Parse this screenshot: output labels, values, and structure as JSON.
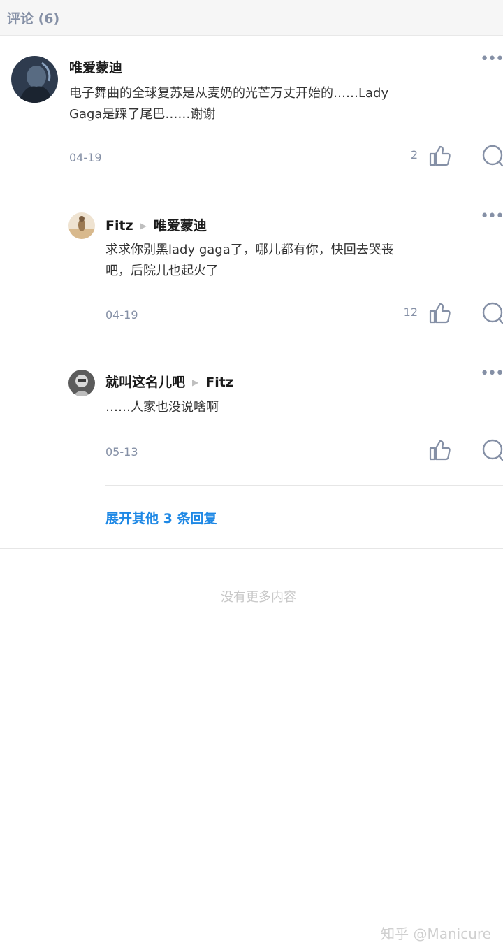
{
  "header": {
    "title": "评论 (6)"
  },
  "comments": [
    {
      "author": "唯爱蒙迪",
      "reply_to": "",
      "content_line1": "电子舞曲的全球复苏是从麦奶的光芒万丈开始的……Lady",
      "content_line2": "Gaga是踩了尾巴……谢谢",
      "date": "04-19",
      "likes": "2"
    },
    {
      "author": "Fitz",
      "reply_to": "唯爱蒙迪",
      "content_line1": "求求你别黑lady gaga了，哪儿都有你，快回去哭丧",
      "content_line2": "吧，后院儿也起火了",
      "date": "04-19",
      "likes": "12"
    },
    {
      "author": "就叫这名儿吧",
      "reply_to": "Fitz",
      "content_line1": "……人家也没说啥啊",
      "content_line2": "",
      "date": "05-13",
      "likes": ""
    }
  ],
  "expand_label": "展开其他 3 条回复",
  "end_text": "没有更多内容",
  "watermark": "知乎 @Manicure",
  "icons": {
    "like": "thumbs-up-icon",
    "reply": "comment-bubble-icon",
    "more": "more-dots-icon",
    "arrow": "reply-arrow-icon"
  },
  "colors": {
    "accent": "#1e88e5",
    "muted": "#8590a6"
  }
}
